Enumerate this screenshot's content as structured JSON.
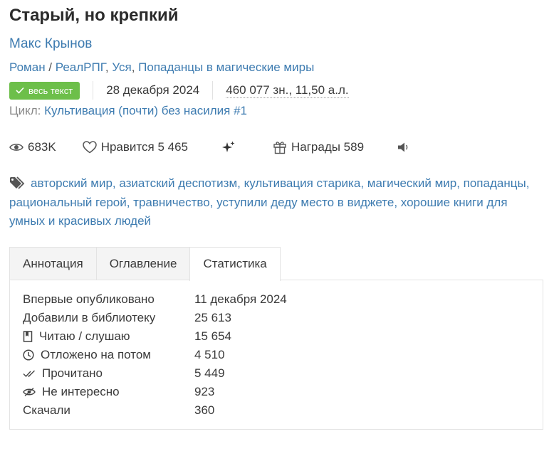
{
  "book": {
    "title": "Старый, но крепкий",
    "author": "Макс Крынов",
    "genres": [
      "Роман",
      "РеалРПГ",
      "Уся",
      "Попаданцы в магические миры"
    ],
    "badge_label": "весь текст",
    "date": "28 декабря 2024",
    "size": "460 077 зн., 11,50 а.л.",
    "cycle_label": "Цикл:",
    "cycle_value": "Культивация (почти) без насилия #1"
  },
  "stats_bar": {
    "views": "683K",
    "likes": "Нравится 5 465",
    "awards": "Награды 589"
  },
  "icons": [
    "eye-icon",
    "heart-icon",
    "sparkle-icon",
    "gift-icon",
    "speaker-icon",
    "tag-icon",
    "check-icon",
    "book-icon",
    "clock-icon",
    "double-check-icon",
    "eye-slash-icon"
  ],
  "tags": "авторский мир, азиатский деспотизм, культивация старика, магический мир, попаданцы, рациональный герой, травничество, уступили деду место в виджете, хорошие книги для умных и красивых людей",
  "tabs": [
    {
      "label": "Аннотация",
      "active": false
    },
    {
      "label": "Оглавление",
      "active": false
    },
    {
      "label": "Статистика",
      "active": true
    }
  ],
  "statistics": [
    {
      "label": "Впервые опубликовано",
      "value": "11 декабря 2024"
    },
    {
      "label": "Добавили в библиотеку",
      "value": "25 613"
    },
    {
      "label": "Читаю / слушаю",
      "value": "15 654"
    },
    {
      "label": "Отложено на потом",
      "value": "4 510"
    },
    {
      "label": "Прочитано",
      "value": "5 449"
    },
    {
      "label": "Не интересно",
      "value": "923"
    },
    {
      "label": "Скачали",
      "value": "360"
    }
  ],
  "colors": {
    "link": "#3d7bb0",
    "badge": "#6dbf4a",
    "text": "#3a3a3a",
    "muted": "#888888"
  }
}
